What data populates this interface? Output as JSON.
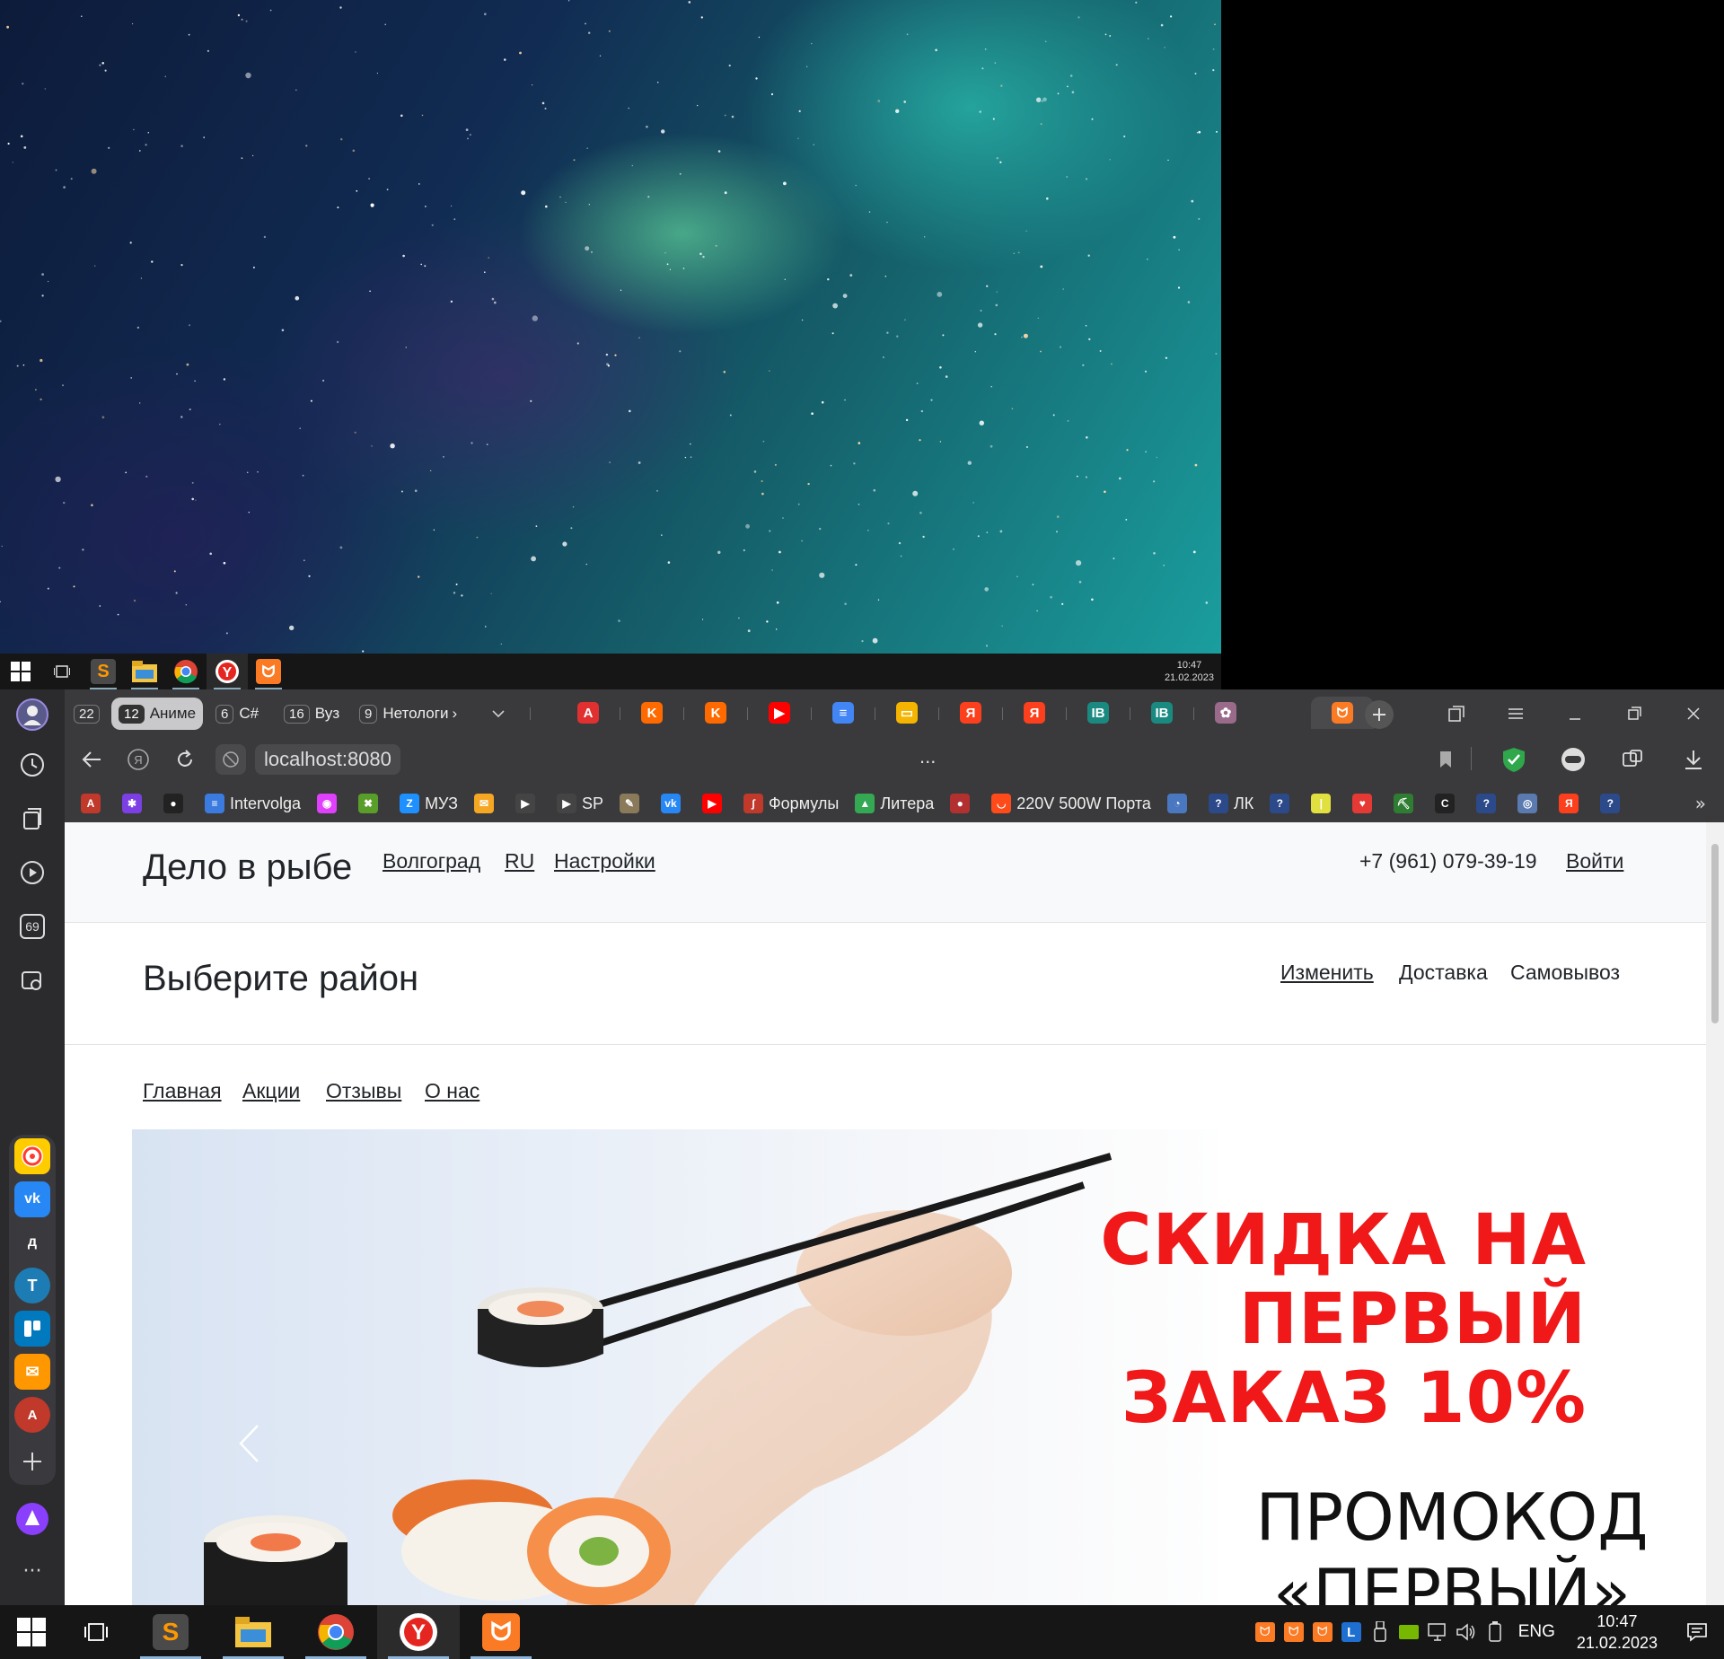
{
  "mini_taskbar": {
    "time": "10:47",
    "date": "21.02.2023",
    "apps": [
      "start-icon",
      "task-view-icon",
      "sublime-icon",
      "explorer-icon",
      "chrome-icon",
      "yandex-browser-icon",
      "xampp-icon"
    ]
  },
  "browser": {
    "tab_groups": [
      {
        "count": "22",
        "label": ""
      },
      {
        "count": "12",
        "label": "Аниме"
      },
      {
        "count": "6",
        "label": "C#"
      },
      {
        "count": "16",
        "label": "Вуз"
      },
      {
        "count": "9",
        "label": "Нетологи"
      }
    ],
    "pinned_tabs": [
      {
        "name": "a-icon",
        "glyph": "A",
        "color": "#e03030"
      },
      {
        "name": "kinopoisk-icon",
        "glyph": "K",
        "color": "#ff6a00"
      },
      {
        "name": "kinopoisk-icon-2",
        "glyph": "K",
        "color": "#ff6a00"
      },
      {
        "name": "youtube-icon",
        "glyph": "▶",
        "color": "#ff0000"
      },
      {
        "name": "docs-icon",
        "glyph": "≡",
        "color": "#4285f4"
      },
      {
        "name": "slides-icon",
        "glyph": "▭",
        "color": "#f4b400"
      },
      {
        "name": "yandex-icon",
        "glyph": "Я",
        "color": "#fc3f1d"
      },
      {
        "name": "yandex-icon-2",
        "glyph": "Я",
        "color": "#fc3f1d"
      },
      {
        "name": "dev-icon",
        "glyph": "IB",
        "color": "#1a8a80"
      },
      {
        "name": "dev-icon-2",
        "glyph": "IB",
        "color": "#1a8a80"
      },
      {
        "name": "anime-icon",
        "glyph": "✿",
        "color": "#9a6a8a"
      },
      {
        "name": "xampp-tab-icon",
        "glyph": "ᗢ",
        "color": "#fb7a24"
      }
    ],
    "url": "localhost:8080",
    "page_title_dots": "...",
    "bookmarks": [
      {
        "label": "",
        "name": "translate-bm",
        "glyph": "A",
        "color": "#c0392b"
      },
      {
        "label": "",
        "name": "gallery-bm",
        "glyph": "✱",
        "color": "#7b3fe4"
      },
      {
        "label": "",
        "name": "github-bm",
        "glyph": "●",
        "color": "#222"
      },
      {
        "label": "Intervolga",
        "name": "intervolga-bm",
        "glyph": "≡",
        "color": "#3b7be0"
      },
      {
        "label": "",
        "name": "apps-bm",
        "glyph": "◉",
        "color": "#e040fb"
      },
      {
        "label": "",
        "name": "game-bm",
        "glyph": "✖",
        "color": "#5a9e2a"
      },
      {
        "label": "МУЗ",
        "name": "muz-bm",
        "glyph": "Z",
        "color": "#1e90ff"
      },
      {
        "label": "",
        "name": "mail-bm",
        "glyph": "✉",
        "color": "#f5a623"
      },
      {
        "label": "",
        "name": "play-bm",
        "glyph": "▶",
        "color": "#444"
      },
      {
        "label": "SP",
        "name": "sp-bm",
        "glyph": "▶",
        "color": "#444"
      },
      {
        "label": "",
        "name": "tool-bm",
        "glyph": "✎",
        "color": "#8a7a5a"
      },
      {
        "label": "",
        "name": "vk-bm",
        "glyph": "vk",
        "color": "#2787f5"
      },
      {
        "label": "",
        "name": "youtube-bm",
        "glyph": "▶",
        "color": "#ff0000"
      },
      {
        "label": "Формулы",
        "name": "formulas-bm",
        "glyph": "∫",
        "color": "#c0392b"
      },
      {
        "label": "Литера",
        "name": "litera-bm",
        "glyph": "▲",
        "color": "#34a853"
      },
      {
        "label": "",
        "name": "fruit-bm",
        "glyph": "●",
        "color": "#b23030"
      },
      {
        "label": "220V 500W Порта",
        "name": "aliexpress-bm",
        "glyph": "◡",
        "color": "#ff4a1a"
      },
      {
        "label": "",
        "name": "clock-bm",
        "glyph": "◔",
        "color": "#4a78c0"
      },
      {
        "label": "ЛК",
        "name": "lk-bm",
        "glyph": "?",
        "color": "#2c4a8a"
      },
      {
        "label": "",
        "name": "q-bm",
        "glyph": "?",
        "color": "#2c4a8a"
      },
      {
        "label": "",
        "name": "bar-bm",
        "glyph": "|",
        "color": "#e0e040"
      },
      {
        "label": "",
        "name": "heart-bm",
        "glyph": "♥",
        "color": "#e53935"
      },
      {
        "label": "",
        "name": "pick-bm",
        "glyph": "⛏",
        "color": "#2e7d32"
      },
      {
        "label": "",
        "name": "cc-bm",
        "glyph": "C",
        "color": "#222"
      },
      {
        "label": "",
        "name": "q2-bm",
        "glyph": "?",
        "color": "#2c4a8a"
      },
      {
        "label": "",
        "name": "globe-bm",
        "glyph": "◎",
        "color": "#5a7ab0"
      },
      {
        "label": "",
        "name": "yandex-bm",
        "glyph": "Я",
        "color": "#fc3f1d"
      },
      {
        "label": "",
        "name": "q3-bm",
        "glyph": "?",
        "color": "#2c4a8a"
      }
    ],
    "sidebar_counter": "69"
  },
  "site": {
    "brand": "Дело в рыбе",
    "city": "Волгоград",
    "lang": "RU",
    "settings": "Настройки",
    "phone": "+7 (961) 079-39-19",
    "login": "Войти",
    "district_title": "Выберите район",
    "change": "Изменить",
    "delivery": "Доставка",
    "pickup": "Самовывоз",
    "nav": [
      "Главная",
      "Акции",
      "Отзывы",
      "О нас"
    ],
    "banner": {
      "promo_line1": "СКИДКА НА",
      "promo_line2": "ПЕРВЫЙ",
      "promo_line3": "ЗАКАЗ 10%",
      "promocode_line1": "ПРОМОКОД",
      "promocode_line2": "«ПЕРВЫЙ»"
    }
  },
  "taskbar": {
    "lang": "ENG",
    "time": "10:47",
    "date": "21.02.2023"
  }
}
